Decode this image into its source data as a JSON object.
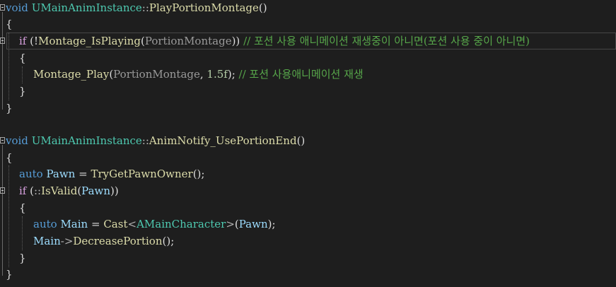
{
  "editor": {
    "theme_bg": "#1e1e1e",
    "func1": {
      "kw_void": "void",
      "class": "UMainAnimInstance",
      "scope": "::",
      "name": "PlayPortionMontage",
      "parens": "()",
      "open_brace": "{",
      "if_kw": "if",
      "if_open": " (!",
      "is_playing": "Montage_IsPlaying",
      "p1": "(",
      "arg": "PortionMontage",
      "p2": "))",
      "comment1": " // 포션 사용 애니메이션 재생중이 아니면(포션 사용 중이 아니면)",
      "inner_open": "{",
      "play": "Montage_Play",
      "p3": "(",
      "arg2": "PortionMontage",
      "comma": ", ",
      "rate": "1.5f",
      "p4": ");",
      "comment2": " // 포션 사용애니메이션 재생",
      "inner_close": "}",
      "close_brace": "}"
    },
    "func2": {
      "kw_void": "void",
      "class": "UMainAnimInstance",
      "scope": "::",
      "name": "AnimNotify_UsePortionEnd",
      "parens": "()",
      "open_brace": "{",
      "auto": "auto",
      "pawn": "Pawn",
      "assign": " = ",
      "getowner": "TryGetPawnOwner",
      "call_end": "();",
      "if_kw": "if",
      "if_open": " (",
      "scope2": "::",
      "isvalid": "IsValid",
      "p1": "(",
      "pawn2": "Pawn",
      "p2": "))",
      "inner_open": "{",
      "auto2": "auto",
      "main": "Main",
      "assign2": " = ",
      "cast": "Cast",
      "lt": "<",
      "mchar": "AMainCharacter",
      "gt": ">",
      "p3": "(",
      "pawn3": "Pawn",
      "p4": ");",
      "main2": "Main",
      "arrow": "->",
      "decrease": "DecreasePortion",
      "call_end2": "();",
      "inner_close": "}",
      "close_brace": "}"
    }
  }
}
